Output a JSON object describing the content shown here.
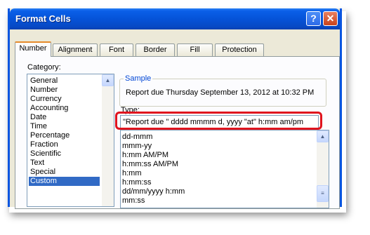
{
  "window": {
    "title": "Format Cells",
    "help_label": "?",
    "close_label": "✕"
  },
  "tabs": [
    {
      "label": "Number"
    },
    {
      "label": "Alignment"
    },
    {
      "label": "Font"
    },
    {
      "label": "Border"
    },
    {
      "label": "Fill"
    },
    {
      "label": "Protection"
    }
  ],
  "category": {
    "label": "Category:",
    "items": [
      "General",
      "Number",
      "Currency",
      "Accounting",
      "Date",
      "Time",
      "Percentage",
      "Fraction",
      "Scientific",
      "Text",
      "Special",
      "Custom"
    ],
    "selected": "Custom"
  },
  "sample": {
    "label": "Sample",
    "value": "Report due  Thursday September 13, 2012 at 10:32 PM"
  },
  "type": {
    "label": "Type:",
    "value": "\"Report due \" dddd mmmm d, yyyy \"at\" h:mm am/pm",
    "items": [
      "dd-mmm",
      "mmm-yy",
      "h:mm AM/PM",
      "h:mm:ss AM/PM",
      "h:mm",
      "h:mm:ss",
      "dd/mm/yyyy h:mm",
      "mm:ss"
    ]
  },
  "colors": {
    "accent": "#0a5fe8",
    "selection": "#316ac5",
    "highlight": "#e0141e"
  }
}
